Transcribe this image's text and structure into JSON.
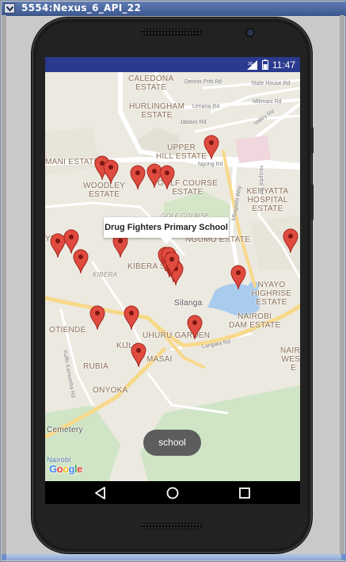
{
  "window": {
    "title": "5554:Nexus_6_API_22",
    "menu_icon": "chevron-down-icon"
  },
  "status_bar": {
    "time": "11:47",
    "network": "3G",
    "icons": [
      "signal-icon",
      "battery-icon"
    ]
  },
  "map": {
    "labels": {
      "caledonia": "CALEDONA\nESTATE",
      "hurlingham": "HURLINGHAM\nESTATE",
      "upper_hill": "UPPER\nHILL ESTATE",
      "kimani": "MANI ESTATE",
      "woodley": "WOODLEY\nESTATE",
      "golf_course_estate": "GOLF COURSE\nESTATE",
      "golf_course": "GOLF COURSE",
      "kenyatta": "KENYATTA\nHOSPITAL ESTATE",
      "ngumo": "NGUMO ESTATE",
      "kibera_south": "KIBERA SO...",
      "kibera": "KIBERA",
      "ye": "YE",
      "nyayo": "NYAYO\nHIGHRISE ESTATE",
      "silanga": "Silanga",
      "nairobi_dam": "NAIROBI\nDAM ESTATE",
      "otiende": "OTIENDE",
      "uhuru_garden": "UHURU GARDEN",
      "kijl": "KIJL",
      "masai": "MASAI",
      "rubia": "RUBIA",
      "nairobi_west": "NAIRO\nWEST E",
      "onyoka": "ONYOKA",
      "cemetery": "Cemetery",
      "nairobi": "Nairobi"
    },
    "roads": {
      "dennis_pritt": "Dennis Pritt Rd",
      "state_house": "State House Rd",
      "milimani": "Milimani Rd",
      "lenana": "Lenana Rd",
      "jabavu": "Jabavu Rd",
      "valley": "Valley Rd",
      "ngong": "Ngong Rd",
      "hospital": "Hospital Rd",
      "mbagathi": "Mbagathi Way",
      "langata": "Langata Rd",
      "kuffo": "Kuffo Kamumba Rd"
    },
    "info_window": "Drug Fighters Primary School",
    "marker_count": 22,
    "attribution": "Google"
  },
  "toast": {
    "text": "school"
  },
  "nav": {
    "back": "back-icon",
    "home": "home-icon",
    "recents": "recents-icon"
  },
  "colors": {
    "status_bar": "#2a3a8f",
    "marker": "#e04b3f",
    "map_bg": "#ece9e1",
    "road": "#ffffff",
    "major_road": "#f8d98a",
    "water": "#a9cbee",
    "park": "#cfe5c6"
  }
}
